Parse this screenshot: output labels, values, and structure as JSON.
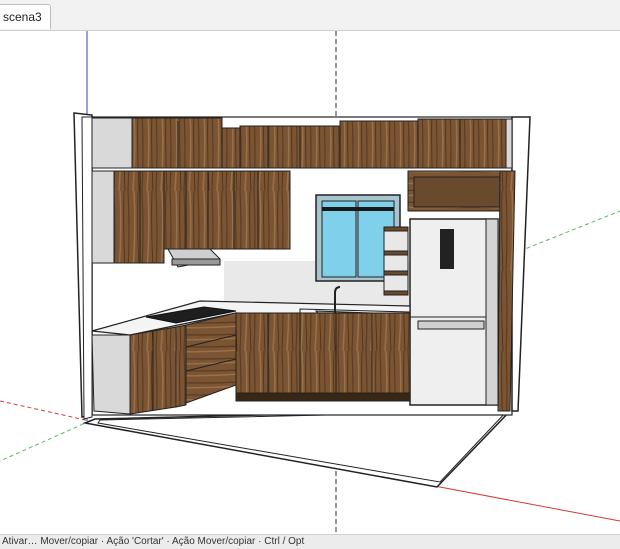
{
  "tabs": [
    {
      "label": "scena3",
      "active": true
    }
  ],
  "statusbar": {
    "text": "Ativar… Mover/copiar · Ação 'Cortar' · Ação Mover/copiar · Ctrl / Opt"
  },
  "colors": {
    "sky": "#ffffff",
    "ground": "#ffffff",
    "wood_dark": "#5a3c22",
    "wood_mid": "#7b5533",
    "wood_light": "#9a7049",
    "carcass": "#d9d9d9",
    "counter": "#f4f4f4",
    "glass": "#7fd0ea",
    "axis_red": "#d23a3a",
    "axis_green": "#5cb85c",
    "axis_blue": "#3a3ad2"
  },
  "scene": {
    "model": "kitchen",
    "objects": [
      "upper-cabinets",
      "lower-cabinets",
      "window",
      "range-hood",
      "cooktop",
      "sink-faucet",
      "refrigerator",
      "shelves",
      "drawers"
    ]
  }
}
